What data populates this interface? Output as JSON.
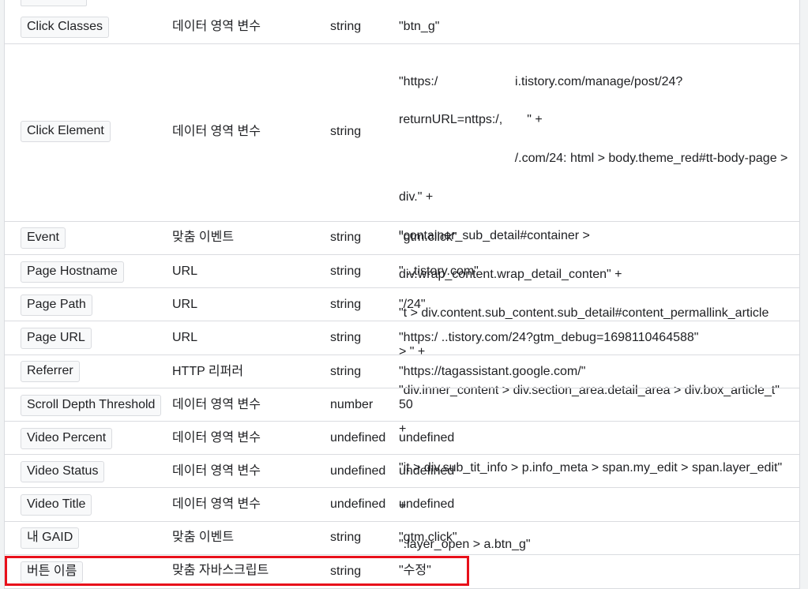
{
  "rows": [
    {
      "name": "Click Classes",
      "type": "데이터 영역 변수",
      "dtype": "string",
      "value": "\"btn_g\""
    },
    {
      "name": "Click Element",
      "type": "데이터 영역 변수",
      "dtype": "string",
      "value_lines": [
        "\"https:/                      i.tistory.com/manage/post/24?",
        "returnURL=nttps:/,       \" +",
        "                                 /.com/24: html > body.theme_red#tt-body-page >",
        "div.\" +",
        "\"container_sub_detail#container >",
        "div.wrap_content.wrap_detail_conten\" +",
        "\"t > div.content.sub_content.sub_detail#content_permallink_article",
        "> \" +",
        "\"div.inner_content > div.section_area.detail_area > div.box_article_t\"",
        "+",
        "\"it > div.sub_tit_info > p.info_meta > span.my_edit > span.layer_edit\"",
        "+",
        "\".layer_open > a.btn_g\""
      ]
    },
    {
      "name": "Event",
      "type": "맞춤 이벤트",
      "dtype": "string",
      "value": "\"gtm.click\""
    },
    {
      "name": "Page Hostname",
      "type": "URL",
      "dtype": "string",
      "value": "\"                                  ..tistory.com\""
    },
    {
      "name": "Page Path",
      "type": "URL",
      "dtype": "string",
      "value": "\"/24\""
    },
    {
      "name": "Page URL",
      "type": "URL",
      "dtype": "string",
      "value": "\"https:/                         ..tistory.com/24?gtm_debug=1698110464588\""
    },
    {
      "name": "Referrer",
      "type": "HTTP 리퍼러",
      "dtype": "string",
      "value": "\"https://tagassistant.google.com/\""
    },
    {
      "name": "Scroll Depth Threshold",
      "type": "데이터 영역 변수",
      "dtype": "number",
      "value": "50"
    },
    {
      "name": "Video Percent",
      "type": "데이터 영역 변수",
      "dtype": "undefined",
      "value": "undefined"
    },
    {
      "name": "Video Status",
      "type": "데이터 영역 변수",
      "dtype": "undefined",
      "value": "undefined"
    },
    {
      "name": "Video Title",
      "type": "데이터 영역 변수",
      "dtype": "undefined",
      "value": "undefined"
    },
    {
      "name": "내 GAID",
      "type": "맞춤 이벤트",
      "dtype": "string",
      "value": "\"gtm.click\""
    },
    {
      "name": "버튼 이름",
      "type": "맞춤 자바스크립트",
      "dtype": "string",
      "value": "\"수정\""
    }
  ],
  "highlight_color": "#e8101a"
}
